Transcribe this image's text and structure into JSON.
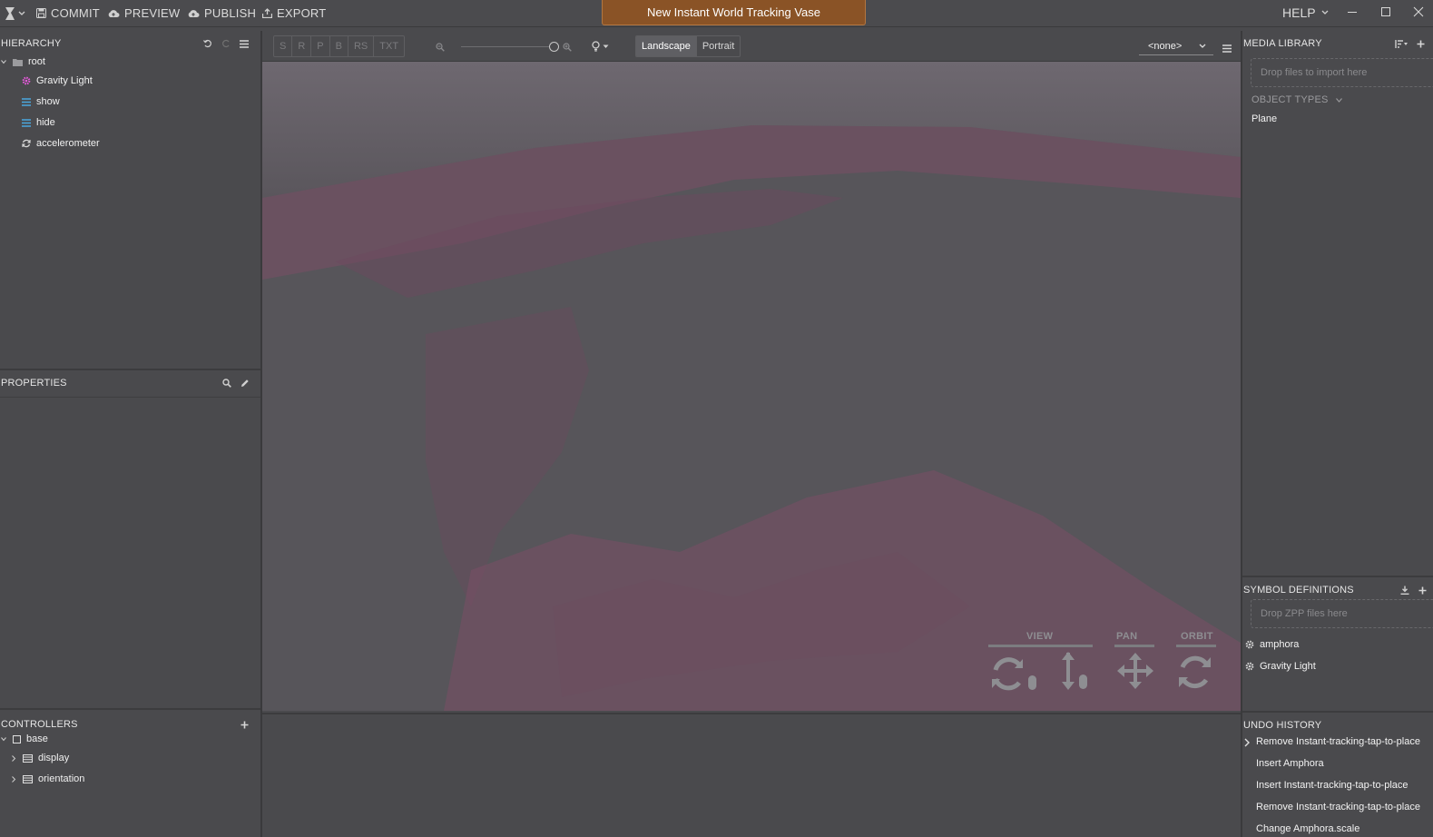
{
  "toolbar": {
    "commit": "COMMIT",
    "preview": "PREVIEW",
    "publish": "PUBLISH",
    "export": "EXPORT",
    "title": "New Instant World Tracking Vase",
    "help": "HELP"
  },
  "hierarchy": {
    "header": "HIERARCHY",
    "items": [
      {
        "label": "root",
        "icon": "folder-icon"
      },
      {
        "label": "Gravity Light",
        "icon": "gear-icon"
      },
      {
        "label": "show",
        "icon": "list-icon"
      },
      {
        "label": "hide",
        "icon": "list-icon"
      },
      {
        "label": "accelerometer",
        "icon": "refresh-icon"
      }
    ]
  },
  "properties": {
    "header": "PROPERTIES"
  },
  "controllers": {
    "header": "CONTROLLERS",
    "items": [
      {
        "label": "base",
        "icon": "square-icon"
      },
      {
        "label": "display",
        "icon": "table-icon"
      },
      {
        "label": "orientation",
        "icon": "table-icon"
      }
    ]
  },
  "viewport": {
    "transform_modes": [
      "S",
      "R",
      "P",
      "B",
      "RS",
      "TXT"
    ],
    "zoom_level": 1.0,
    "orientation": {
      "landscape": "Landscape",
      "portrait": "Portrait",
      "selected": "Landscape"
    },
    "camera_select": "<none>",
    "nav": {
      "view": "VIEW",
      "pan": "PAN",
      "orbit": "ORBIT"
    }
  },
  "media_library": {
    "header": "MEDIA LIBRARY",
    "drop_hint": "Drop files to import here",
    "object_types_label": "OBJECT TYPES",
    "object_types": [
      "Plane"
    ]
  },
  "symbol_definitions": {
    "header": "SYMBOL DEFINITIONS",
    "drop_hint": "Drop ZPP files here",
    "items": [
      "amphora",
      "Gravity Light"
    ]
  },
  "undo_history": {
    "header": "UNDO HISTORY",
    "items": [
      "Remove Instant-tracking-tap-to-place",
      "Insert Amphora",
      "Insert Instant-tracking-tap-to-place",
      "Remove Instant-tracking-tap-to-place",
      "Change Amphora.scale"
    ]
  },
  "colors": {
    "title_banner": "#8a5326",
    "panel_bg": "#4a4a4d",
    "viewport_bg": "#57555a",
    "terrain_tint": "#7a4e66"
  }
}
